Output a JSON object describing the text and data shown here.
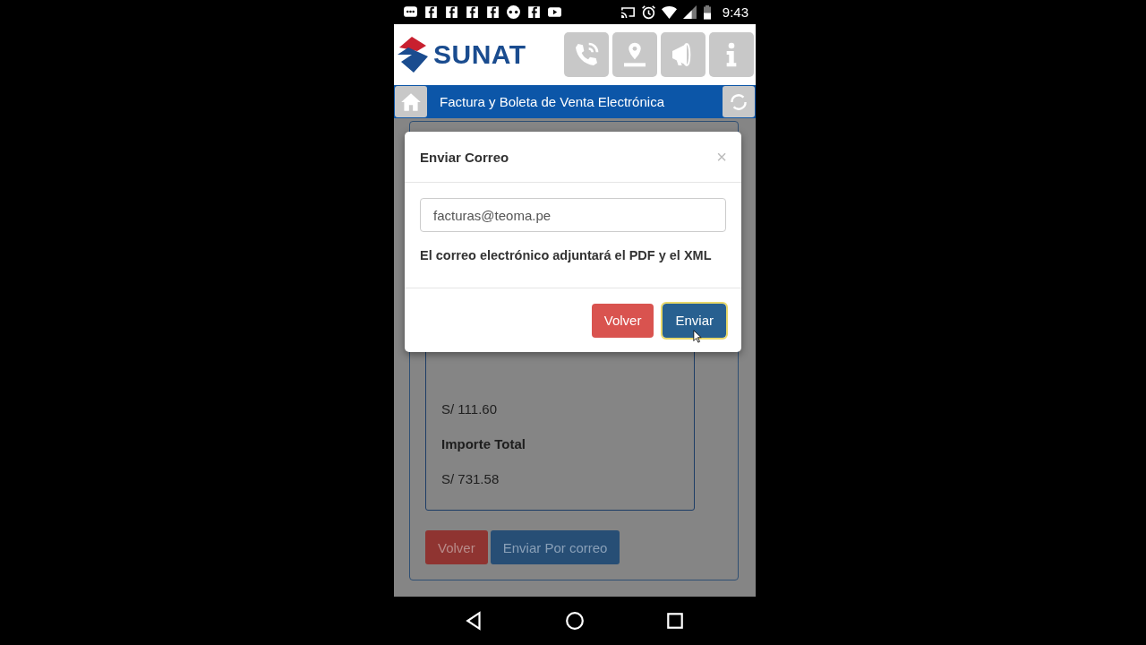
{
  "status_bar": {
    "time": "9:43"
  },
  "header": {
    "logo": "SUNAT"
  },
  "title_bar": {
    "title": "Factura y Boleta de Venta Electrónica"
  },
  "page": {
    "lines": [
      {
        "kind": "value",
        "text": "S/ 111.60"
      },
      {
        "kind": "label",
        "text": "Importe Total"
      },
      {
        "kind": "value",
        "text": "S/ 731.58"
      }
    ],
    "buttons": [
      {
        "label": "Volver",
        "kind": "danger"
      },
      {
        "label": "Enviar Por correo",
        "kind": "primary"
      }
    ]
  },
  "modal": {
    "title": "Enviar Correo",
    "close": "×",
    "email": "facturas@teoma.pe",
    "note": "El correo electrónico adjuntará el PDF y el XML",
    "buttons": [
      {
        "label": "Volver",
        "kind": "danger",
        "focused": false
      },
      {
        "label": "Enviar",
        "kind": "primary",
        "focused": true
      }
    ]
  }
}
